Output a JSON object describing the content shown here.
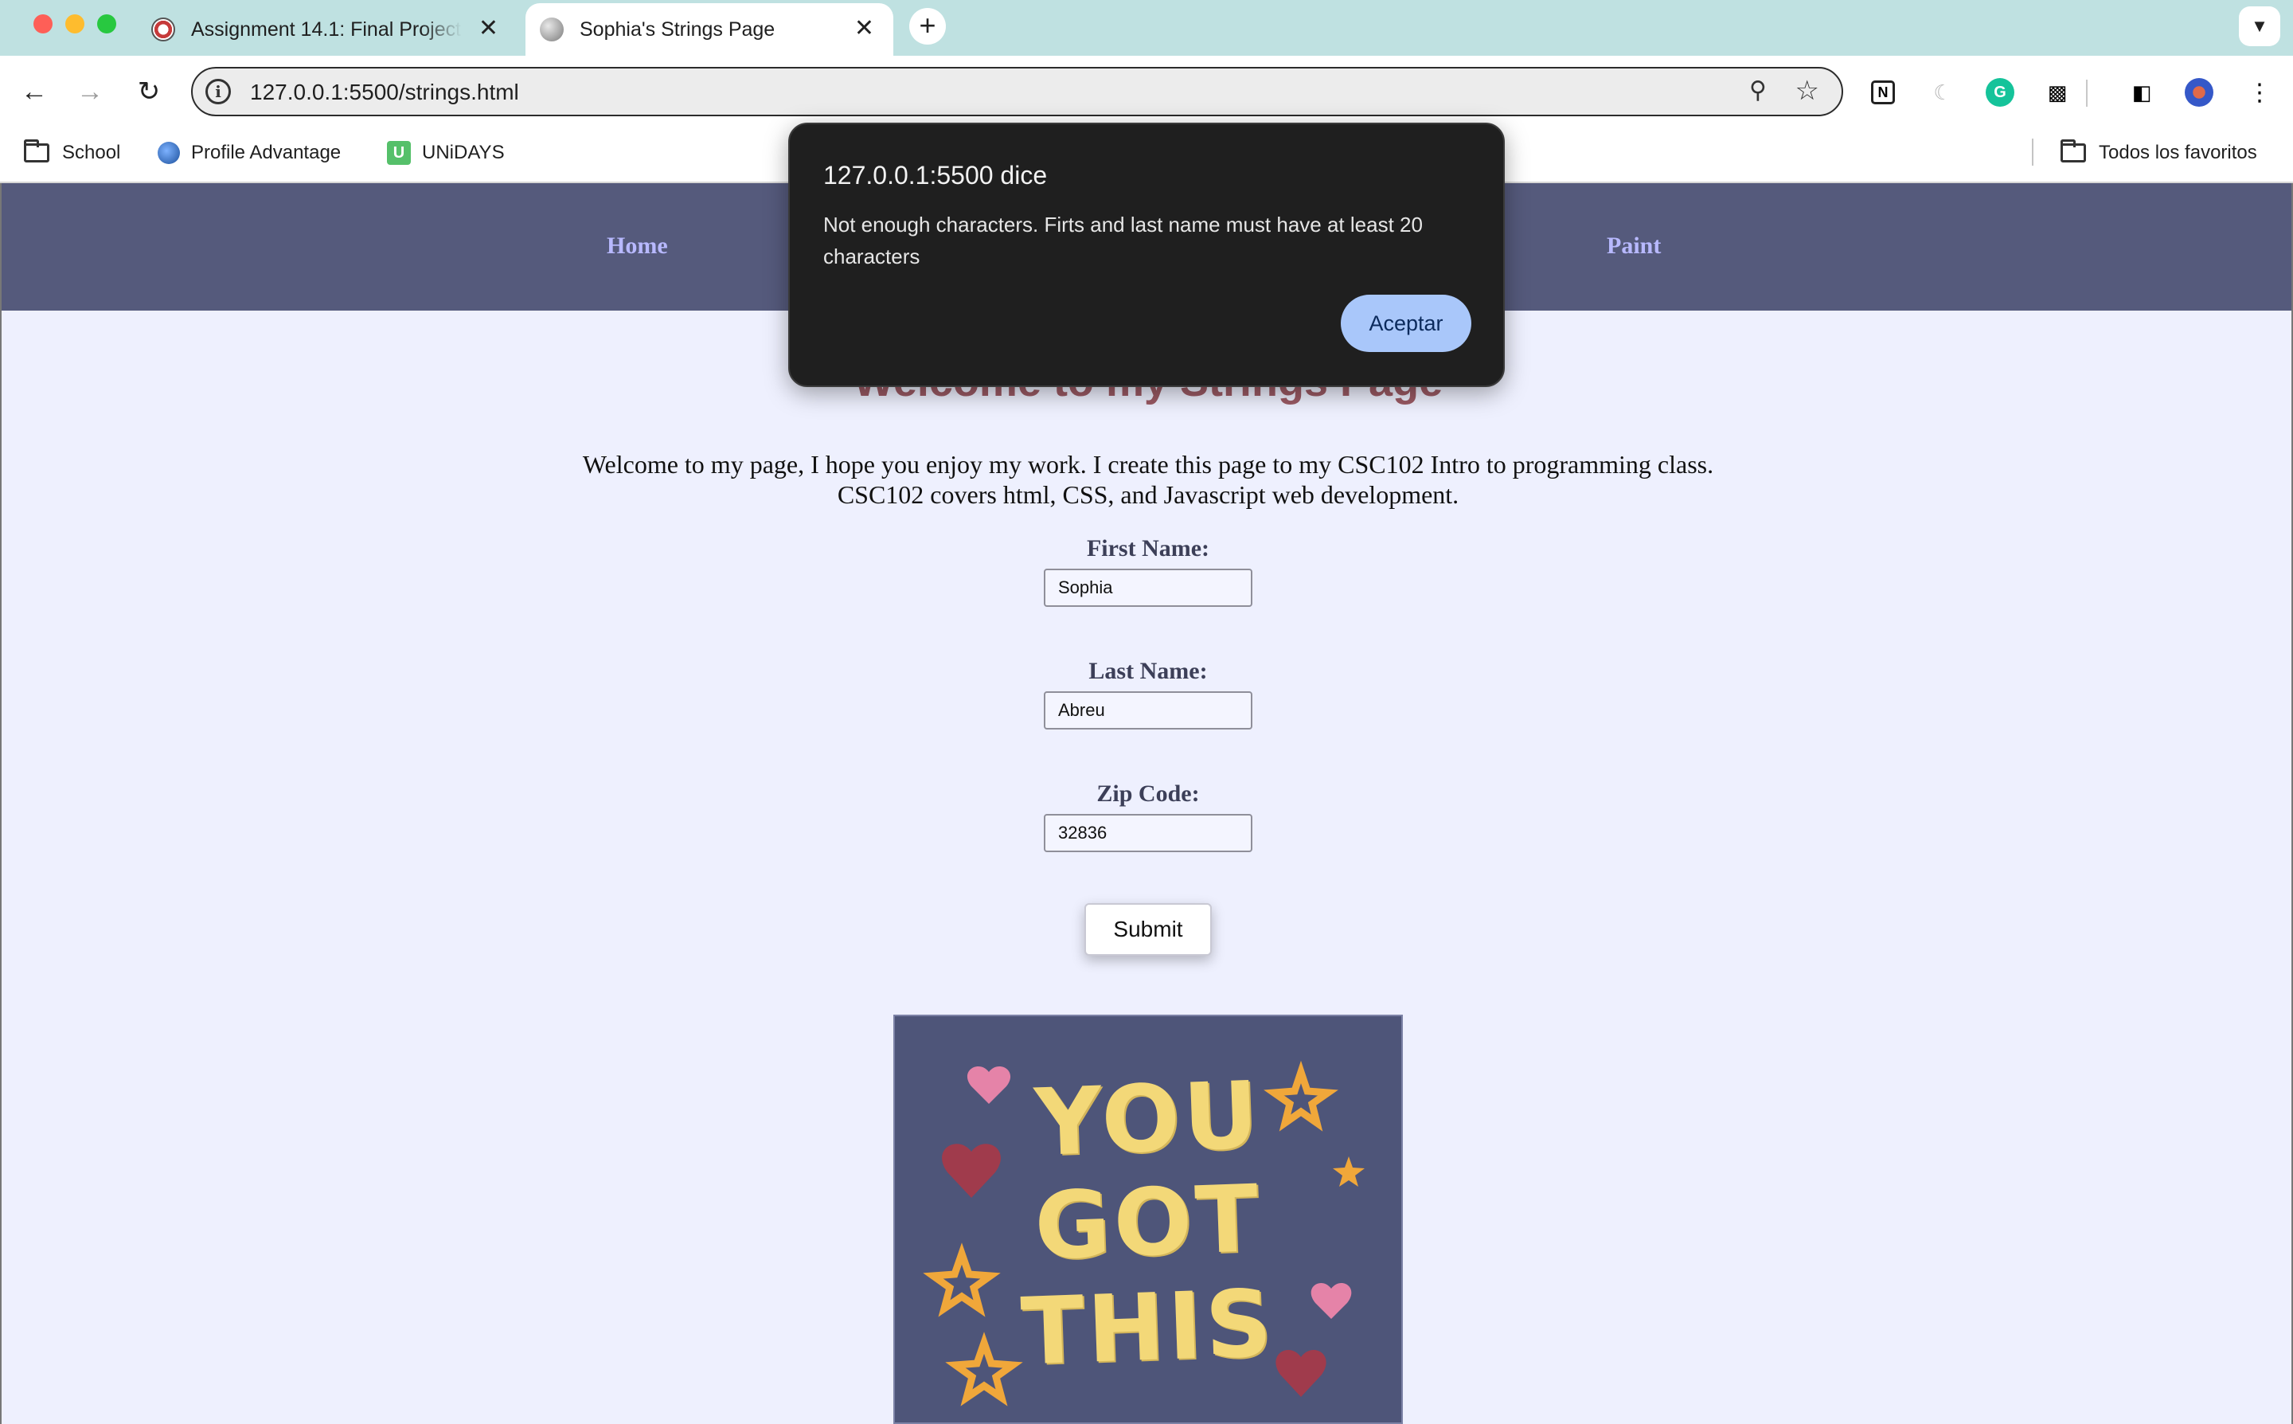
{
  "browser": {
    "tabs": [
      {
        "title": "Assignment 14.1: Final Project",
        "active": false
      },
      {
        "title": "Sophia's Strings Page",
        "active": true
      }
    ],
    "new_tab": "+",
    "tab_close": "✕",
    "url": "127.0.0.1:5500/strings.html",
    "bookmarks": {
      "school": "School",
      "profile_advantage": "Profile Advantage",
      "unidays": "UNiDAYS",
      "unidays_badge": "U",
      "all_bookmarks": "Todos los favoritos"
    },
    "icons": {
      "back": "back-arrow-icon",
      "forward": "forward-arrow-icon",
      "reload": "reload-icon",
      "site_info": "site-info-icon",
      "zoom": "zoom-icon",
      "bookmark_star": "star-icon",
      "extensions": "puzzle-icon",
      "menu": "kebab-menu-icon"
    }
  },
  "site": {
    "nav": {
      "home": "Home",
      "paint": "Paint"
    },
    "heading": "Welcome to my Strings Page",
    "intro_line1": "Welcome to my page, I hope you enjoy my work. I create this page to my CSC102 Intro to programming class.",
    "intro_line2": "CSC102 covers html, CSS, and Javascript web development.",
    "form": {
      "first_name_label": "First Name:",
      "first_name_value": "Sophia",
      "last_name_label": "Last Name:",
      "last_name_value": "Abreu",
      "zip_label": "Zip Code:",
      "zip_value": "32836",
      "submit_label": "Submit"
    },
    "poster": {
      "line1": "YOU",
      "line2": "GOT",
      "line3": "THIS"
    }
  },
  "alert": {
    "title": "127.0.0.1:5500 dice",
    "message": "Not enough characters. Firts and last name must have at least 20 characters",
    "ok_label": "Aceptar"
  },
  "colors": {
    "tab_strip": "#bfe1e1",
    "site_nav": "#555a7c",
    "page_bg": "#eef0fe",
    "nav_link": "#b8b9ff",
    "heading": "#9b5a64",
    "alert_bg": "#1f1f1f",
    "alert_button": "#a9c7fa"
  }
}
